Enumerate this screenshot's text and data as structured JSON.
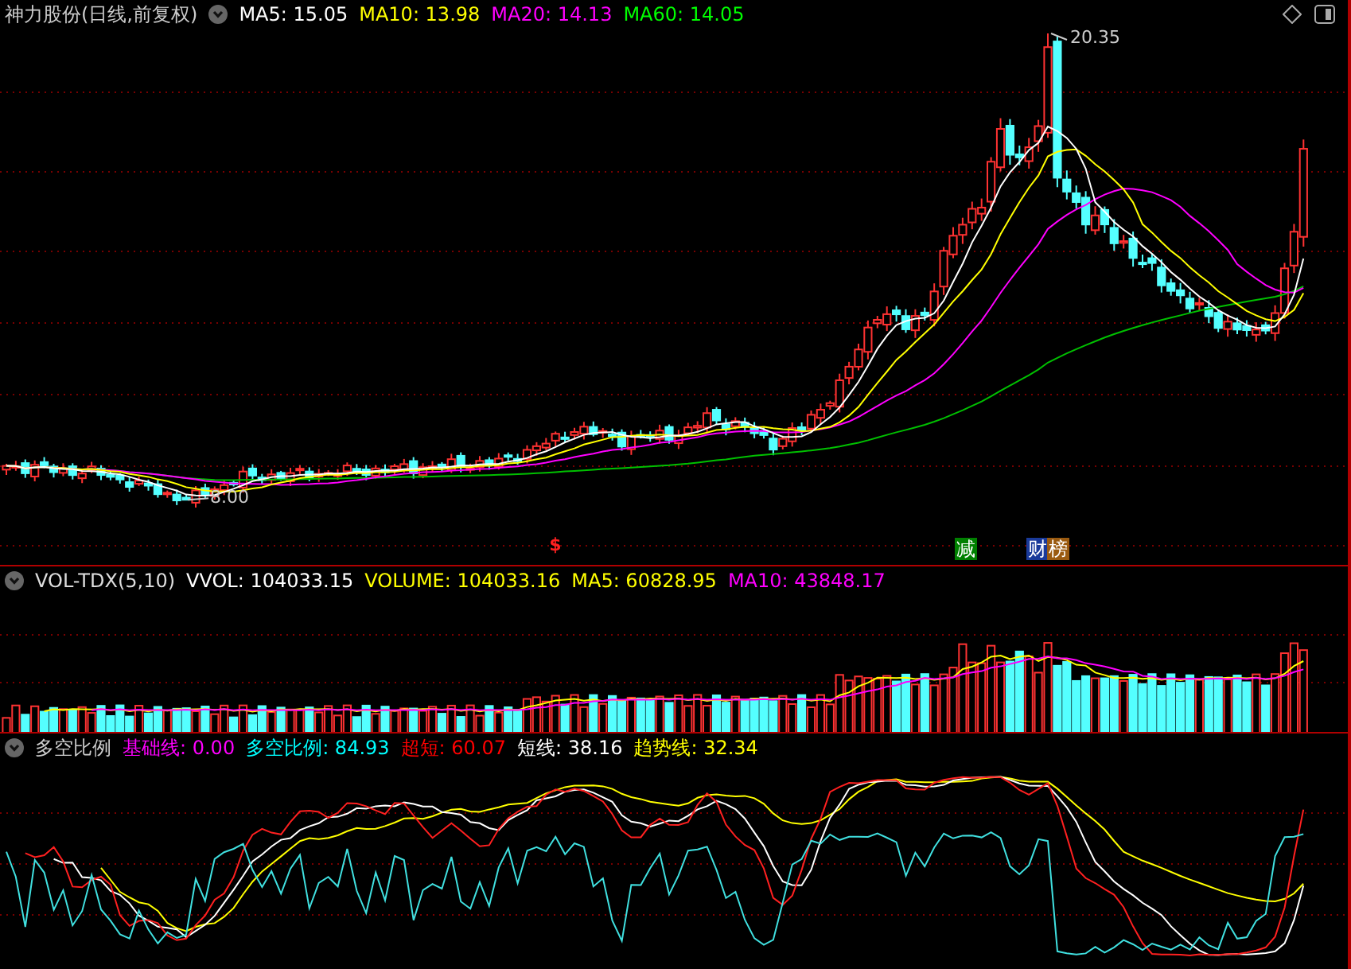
{
  "price_pane": {
    "title": "神力股份(日线,前复权)",
    "items": [
      {
        "text": "MA5: 15.05",
        "color": "#ffffff"
      },
      {
        "text": "MA10: 13.98",
        "color": "#ffff00"
      },
      {
        "text": "MA20: 14.13",
        "color": "#ff00ff"
      },
      {
        "text": "MA60: 14.05",
        "color": "#00ff00"
      }
    ],
    "high_label": "20.35",
    "low_label": "8.00",
    "marker": "$",
    "badges": [
      {
        "text": "减",
        "color": "#008000"
      },
      {
        "text": "财",
        "color": "#1a3a9a"
      },
      {
        "text": "榜",
        "color": "#9a5a10"
      }
    ]
  },
  "volume_pane": {
    "title": "VOL-TDX(5,10)",
    "items": [
      {
        "text": "VVOL: 104033.15",
        "color": "#ffffff"
      },
      {
        "text": "VOLUME: 104033.16",
        "color": "#ffff00"
      },
      {
        "text": "MA5: 60828.95",
        "color": "#ffff00"
      },
      {
        "text": "MA10: 43848.17",
        "color": "#ff00ff"
      }
    ]
  },
  "indicator_pane": {
    "title": "多空比例",
    "items": [
      {
        "text": "基础线: 0.00",
        "color": "#ff00ff"
      },
      {
        "text": "多空比例: 84.93",
        "color": "#00ffff"
      },
      {
        "text": "超短: 60.07",
        "color": "#ff0000"
      },
      {
        "text": "短线: 38.16",
        "color": "#ffffff"
      },
      {
        "text": "趋势线: 32.34",
        "color": "#ffff00"
      }
    ]
  }
}
